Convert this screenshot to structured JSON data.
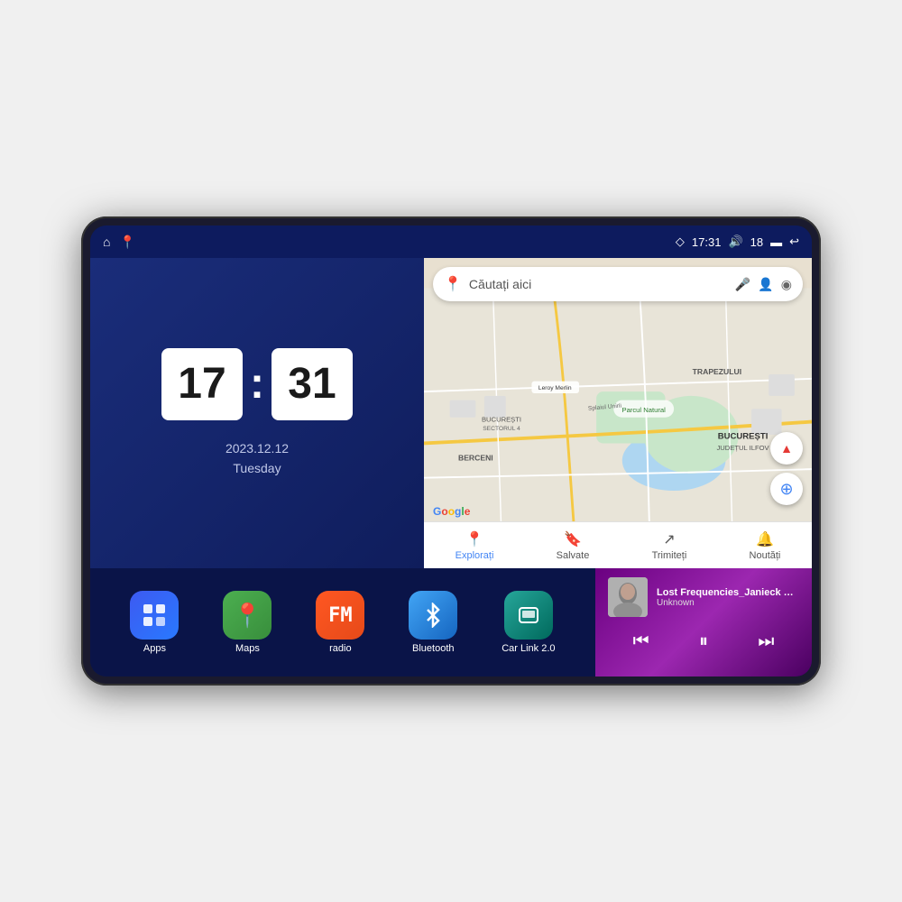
{
  "device": {
    "status_bar": {
      "left_icons": [
        "home",
        "location"
      ],
      "time": "17:31",
      "volume_icon": "🔊",
      "volume_level": "18",
      "battery_icon": "🔋",
      "back_icon": "↩"
    },
    "clock": {
      "hour": "17",
      "minute": "31",
      "date": "2023.12.12",
      "day": "Tuesday"
    },
    "map": {
      "search_placeholder": "Căutați aici",
      "location_name": "Parcul Natural Văcărești",
      "area_name": "BUCUREȘTI",
      "area_sub": "JUDEȚUL ILFOV",
      "district": "BERCENI",
      "street": "Leroy Merlin",
      "nav_items": [
        {
          "icon": "📍",
          "label": "Explorați",
          "active": true
        },
        {
          "icon": "🔖",
          "label": "Salvate",
          "active": false
        },
        {
          "icon": "↗",
          "label": "Trimiteți",
          "active": false
        },
        {
          "icon": "🔔",
          "label": "Noutăți",
          "active": false
        }
      ]
    },
    "apps": [
      {
        "id": "apps",
        "label": "Apps",
        "icon": "⊞",
        "color_class": "icon-apps"
      },
      {
        "id": "maps",
        "label": "Maps",
        "icon": "📍",
        "color_class": "icon-maps"
      },
      {
        "id": "radio",
        "label": "radio",
        "icon": "📻",
        "color_class": "icon-radio"
      },
      {
        "id": "bluetooth",
        "label": "Bluetooth",
        "icon": "🔵",
        "color_class": "icon-bluetooth"
      },
      {
        "id": "carlink",
        "label": "Car Link 2.0",
        "icon": "📱",
        "color_class": "icon-carlink"
      }
    ],
    "music": {
      "title": "Lost Frequencies_Janieck Devy-...",
      "artist": "Unknown",
      "controls": {
        "prev": "⏮",
        "play_pause": "⏸",
        "next": "⏭"
      }
    }
  }
}
